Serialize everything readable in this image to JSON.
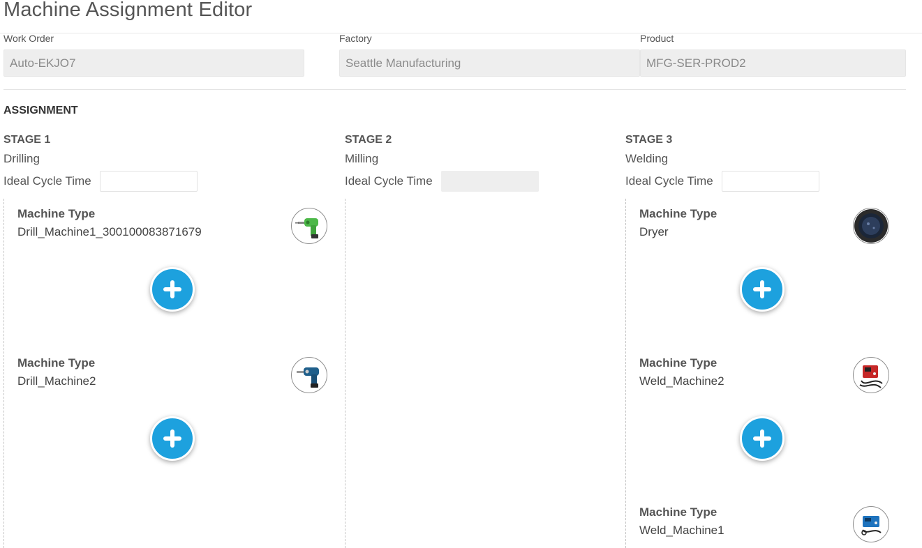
{
  "page": {
    "title": "Machine Assignment Editor"
  },
  "header_fields": [
    {
      "label": "Work Order",
      "value": "Auto-EKJO7"
    },
    {
      "label": "Factory",
      "value": "Seattle Manufacturing"
    },
    {
      "label": "Product",
      "value": "MFG-SER-PROD2"
    }
  ],
  "assignment": {
    "title": "ASSIGNMENT",
    "cycle_time_label": "Ideal Cycle Time",
    "machine_type_label": "Machine Type",
    "stages": [
      {
        "title": "STAGE 1",
        "name": "Drilling",
        "cycle_time": "",
        "cycle_time_disabled": false,
        "machines": [
          {
            "type": "Drill_Machine1_300100083871679",
            "icon": "green-drill-icon"
          },
          {
            "type": "Drill_Machine2",
            "icon": "blue-drill-icon"
          }
        ]
      },
      {
        "title": "STAGE 2",
        "name": "Milling",
        "cycle_time": "",
        "cycle_time_disabled": true,
        "machines": []
      },
      {
        "title": "STAGE 3",
        "name": "Welding",
        "cycle_time": "",
        "cycle_time_disabled": false,
        "machines": [
          {
            "type": "Dryer",
            "icon": "dryer-icon"
          },
          {
            "type": "Weld_Machine2",
            "icon": "red-welder-icon"
          },
          {
            "type": "Weld_Machine1",
            "icon": "blue-welder-icon"
          }
        ]
      }
    ]
  },
  "colors": {
    "add_button": "#1da1de",
    "readonly_field_bg": "#eeeeee",
    "lane_border": "#c4c4c4"
  }
}
